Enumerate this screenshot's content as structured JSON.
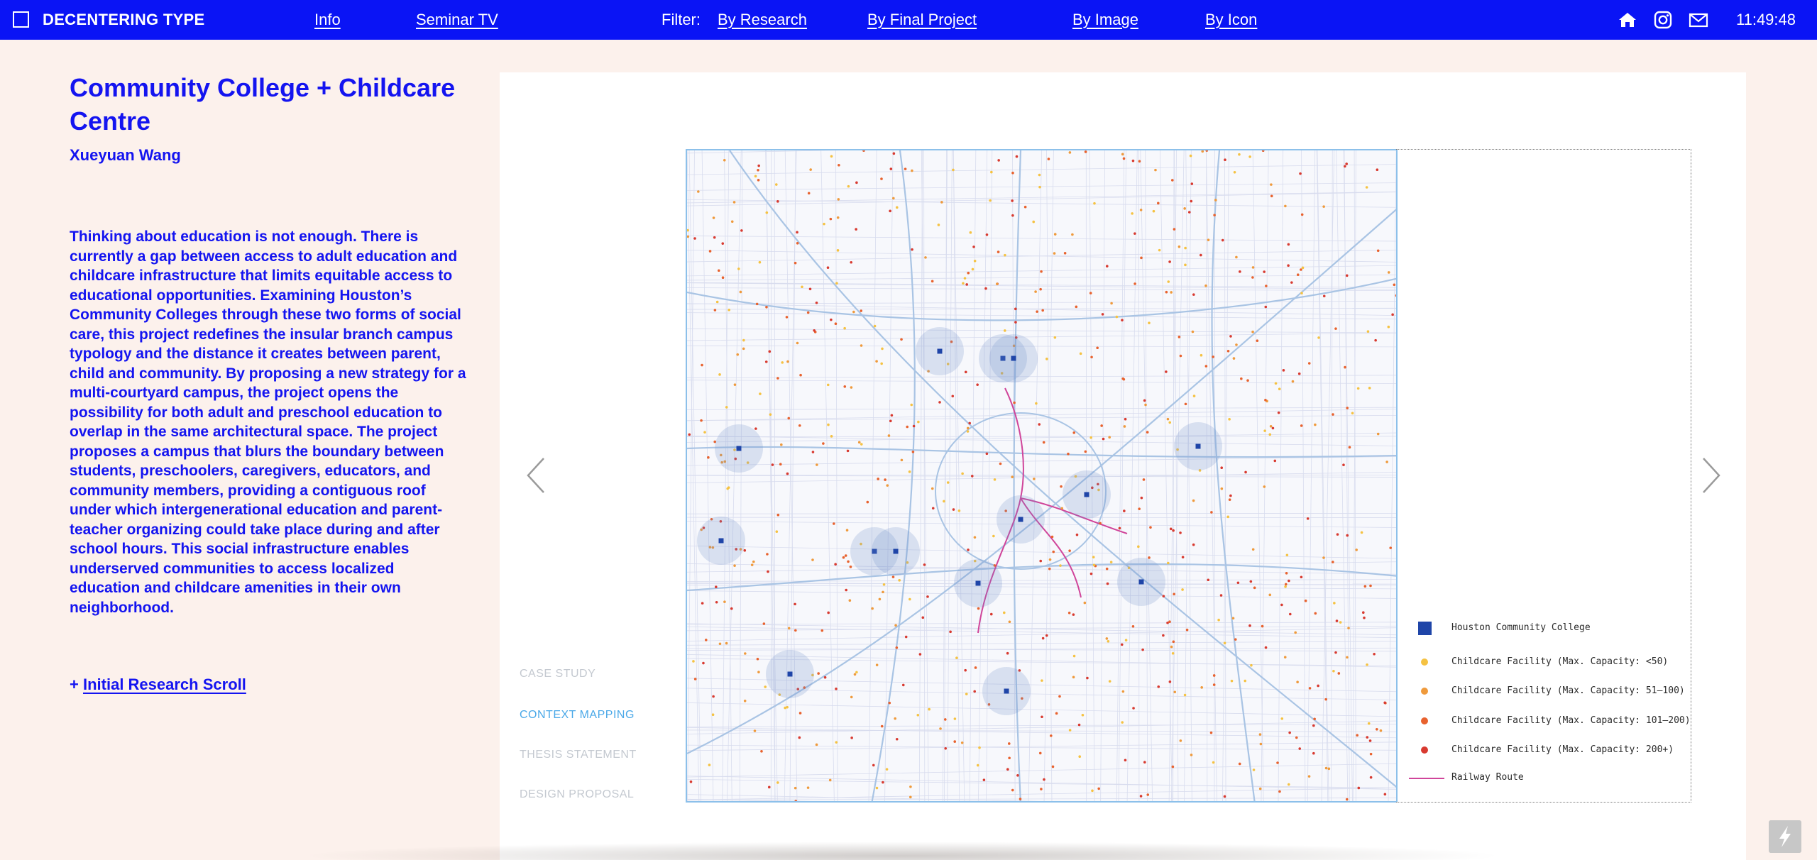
{
  "topbar": {
    "site_title": "DECENTERING TYPE",
    "nav": {
      "info": "Info",
      "seminar_tv": "Seminar TV"
    },
    "filter_label": "Filter:",
    "filters": {
      "by_research": "By Research",
      "by_final_project": "By Final Project",
      "by_image": "By Image",
      "by_icon": "By Icon"
    },
    "icons": [
      "home-icon",
      "instagram-icon",
      "mail-icon"
    ],
    "clock": "11:49:48",
    "bar_color": "#0a14f5"
  },
  "project": {
    "title": "Community College + Childcare Centre",
    "author": "Xueyuan Wang",
    "description": "Thinking about education is not enough. There is currently a gap between access to adult education and childcare infrastructure that limits equitable access to educational opportunities. Examining Houston’s Community Colleges through these two forms of social care, this project redefines the insular branch campus typology and the distance it creates between parent, child and community.  By proposing a new strategy for a multi-courtyard campus, the project opens the possibility for both adult and preschool education to overlap in the same architectural space. The project proposes a campus that blurs the boundary between students, preschoolers, caregivers, educators, and community members, providing a contiguous roof under which intergenerational education and parent-teacher organizing could take place during and after school hours. This social infrastructure enables underserved communities to access localized education and childcare amenities in their own neighborhood.",
    "research_prefix": "+",
    "research_link": "Initial Research Scroll",
    "text_color": "#1414f0"
  },
  "sections": {
    "case_study": "CASE STUDY",
    "context_mapping": "CONTEXT MAPPING",
    "thesis_statement": "THESIS STATEMENT",
    "design_proposal": "DESIGN PROPOSAL",
    "active": "context_mapping",
    "active_color": "#4aa8e8",
    "inactive_color": "#c4c9d0"
  },
  "legend": {
    "college": "Houston Community College",
    "cap_small": "Childcare Facility (Max. Capacity: <50)",
    "cap_medium": "Childcare Facility (Max. Capacity: 51–100)",
    "cap_large": "Childcare Facility (Max. Capacity: 101–200)",
    "cap_xlarge": "Childcare Facility (Max. Capacity: 200+)",
    "railway": "Railway Route",
    "colors": {
      "college": "#1f45a8",
      "cap_small": "#f5c242",
      "cap_medium": "#ef9a3c",
      "cap_large": "#e8622e",
      "cap_xlarge": "#d83a30",
      "railway": "#d0459a"
    }
  },
  "controls": {
    "prev_icon": "chevron-left-icon",
    "next_icon": "chevron-right-icon",
    "bolt_icon": "lightning-icon"
  }
}
